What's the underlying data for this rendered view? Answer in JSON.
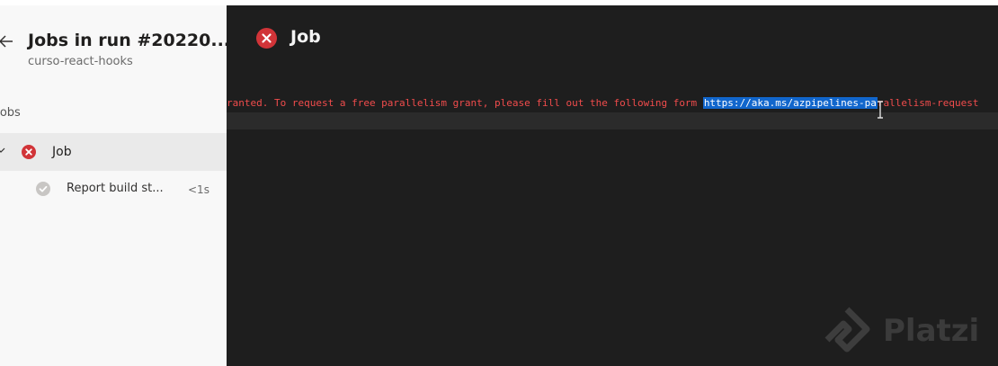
{
  "sidebar": {
    "run_title": "Jobs in run #20220...",
    "run_subtitle": "curso-react-hooks",
    "jobs_heading": "Jobs",
    "job": {
      "label": "Job",
      "status": "failed"
    },
    "step": {
      "label": "Report build st...",
      "duration": "<1s",
      "status": "succeeded"
    }
  },
  "main": {
    "title": "Job",
    "log": {
      "prefix": "ranted. To request a free parallelism grant, please fill out the following form ",
      "url_selected": "https://aka.ms/azpipelines-pa",
      "url_rest": "rallelism-request"
    }
  },
  "watermark": {
    "text": "Platzi"
  },
  "colors": {
    "error": "#d13438",
    "success_gray": "#a19f9d",
    "log_error_text": "#f14c4c",
    "selection": "#1166cc",
    "panel_bg": "#1e1e1e",
    "sidebar_bg": "#f8f8f8",
    "selected_item_bg": "#eaeaea"
  }
}
